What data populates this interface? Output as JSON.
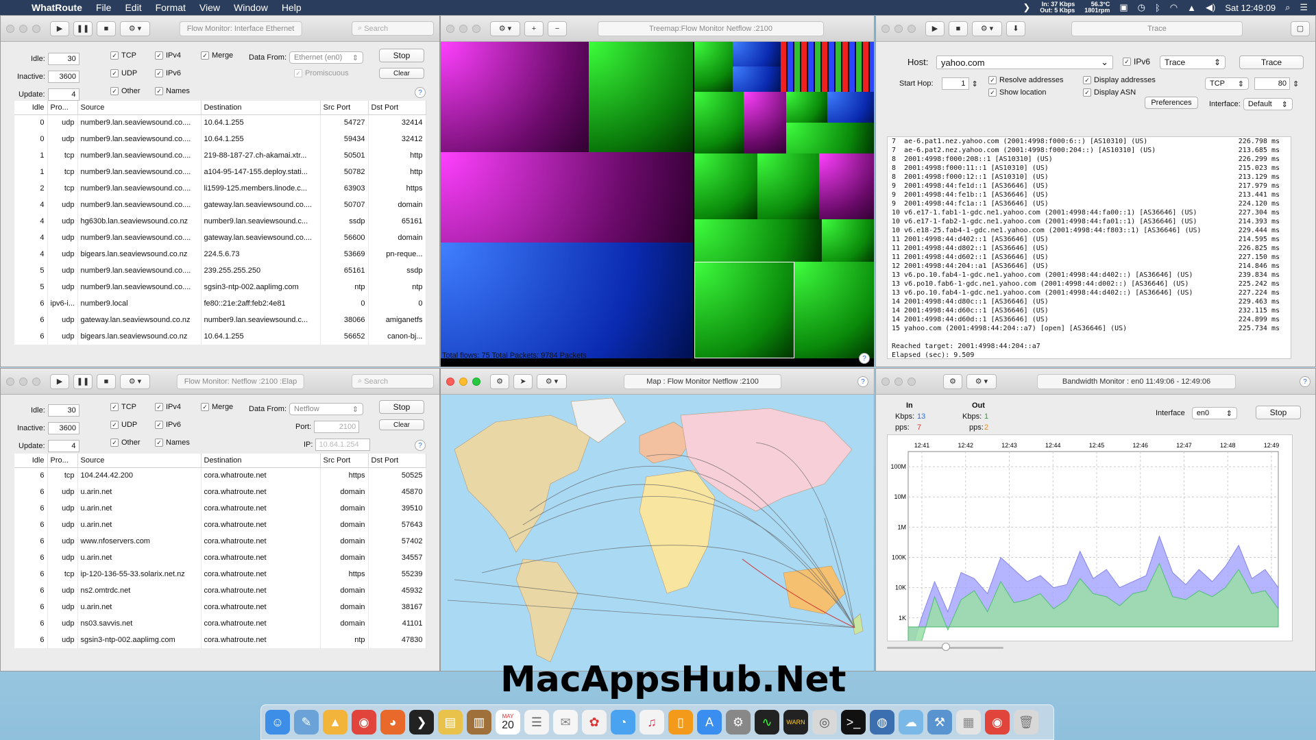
{
  "menubar": {
    "app": "WhatRoute",
    "menus": [
      "File",
      "Edit",
      "Format",
      "View",
      "Window",
      "Help"
    ],
    "net_in": "In: 37 Kbps",
    "net_out": "Out: 5 Kbps",
    "temp": "56.3°C",
    "rpm": "1801rpm",
    "clock": "Sat 12:49:09"
  },
  "fm1": {
    "title": "Flow Monitor: Interface Ethernet",
    "search_placeholder": "Search",
    "idle_label": "Idle:",
    "idle_value": "30",
    "inactive_label": "Inactive:",
    "inactive_value": "3600",
    "update_label": "Update:",
    "update_value": "4",
    "tcp": "TCP",
    "udp": "UDP",
    "other": "Other",
    "ipv4": "IPv4",
    "ipv6": "IPv6",
    "names": "Names",
    "merge": "Merge",
    "promiscuous": "Promiscuous",
    "data_from_label": "Data From:",
    "data_from_value": "Ethernet (en0)",
    "stop": "Stop",
    "clear": "Clear",
    "columns": [
      "Idle",
      "Pro...",
      "Source",
      "Destination",
      "Src Port",
      "Dst Port"
    ],
    "rows": [
      [
        "0",
        "udp",
        "number9.lan.seaviewsound.co....",
        "10.64.1.255",
        "54727",
        "32414"
      ],
      [
        "0",
        "udp",
        "number9.lan.seaviewsound.co....",
        "10.64.1.255",
        "59434",
        "32412"
      ],
      [
        "1",
        "tcp",
        "number9.lan.seaviewsound.co....",
        "219-88-187-27.ch-akamai.xtr...",
        "50501",
        "http"
      ],
      [
        "1",
        "tcp",
        "number9.lan.seaviewsound.co....",
        "a104-95-147-155.deploy.stati...",
        "50782",
        "http"
      ],
      [
        "2",
        "tcp",
        "number9.lan.seaviewsound.co....",
        "li1599-125.members.linode.c...",
        "63903",
        "https"
      ],
      [
        "4",
        "udp",
        "number9.lan.seaviewsound.co....",
        "gateway.lan.seaviewsound.co....",
        "50707",
        "domain"
      ],
      [
        "4",
        "udp",
        "hg630b.lan.seaviewsound.co.nz",
        "number9.lan.seaviewsound.c...",
        "ssdp",
        "65161"
      ],
      [
        "4",
        "udp",
        "number9.lan.seaviewsound.co....",
        "gateway.lan.seaviewsound.co....",
        "56600",
        "domain"
      ],
      [
        "4",
        "udp",
        "bigears.lan.seaviewsound.co.nz",
        "224.5.6.73",
        "53669",
        "pn-reque..."
      ],
      [
        "5",
        "udp",
        "number9.lan.seaviewsound.co....",
        "239.255.255.250",
        "65161",
        "ssdp"
      ],
      [
        "5",
        "udp",
        "number9.lan.seaviewsound.co....",
        "sgsin3-ntp-002.aaplimg.com",
        "ntp",
        "ntp"
      ],
      [
        "6",
        "ipv6-i...",
        "number9.local",
        "fe80::21e:2aff:feb2:4e81",
        "0",
        "0"
      ],
      [
        "6",
        "udp",
        "gateway.lan.seaviewsound.co.nz",
        "number9.lan.seaviewsound.c...",
        "38066",
        "amiganetfs"
      ],
      [
        "6",
        "udp",
        "bigears.lan.seaviewsound.co.nz",
        "10.64.1.255",
        "56652",
        "canon-bj..."
      ]
    ]
  },
  "fm2": {
    "title": "Flow Monitor: Netflow :2100 :Elap",
    "search_placeholder": "Search",
    "idle_label": "Idle:",
    "idle_value": "30",
    "inactive_label": "Inactive:",
    "inactive_value": "3600",
    "update_label": "Update:",
    "update_value": "4",
    "tcp": "TCP",
    "udp": "UDP",
    "other": "Other",
    "ipv4": "IPv4",
    "ipv6": "IPv6",
    "names": "Names",
    "merge": "Merge",
    "data_from_label": "Data From:",
    "data_from_value": "Netflow",
    "port_label": "Port:",
    "port_value": "2100",
    "ip_label": "IP:",
    "ip_placeholder": "10.64.1.254",
    "stop": "Stop",
    "clear": "Clear",
    "columns": [
      "Idle",
      "Pro...",
      "Source",
      "Destination",
      "Src Port",
      "Dst Port"
    ],
    "rows": [
      [
        "6",
        "tcp",
        "104.244.42.200",
        "cora.whatroute.net",
        "https",
        "50525"
      ],
      [
        "6",
        "udp",
        "u.arin.net",
        "cora.whatroute.net",
        "domain",
        "45870"
      ],
      [
        "6",
        "udp",
        "u.arin.net",
        "cora.whatroute.net",
        "domain",
        "39510"
      ],
      [
        "6",
        "udp",
        "u.arin.net",
        "cora.whatroute.net",
        "domain",
        "57643"
      ],
      [
        "6",
        "udp",
        "www.nfoservers.com",
        "cora.whatroute.net",
        "domain",
        "57402"
      ],
      [
        "6",
        "udp",
        "u.arin.net",
        "cora.whatroute.net",
        "domain",
        "34557"
      ],
      [
        "6",
        "tcp",
        "ip-120-136-55-33.solarix.net.nz",
        "cora.whatroute.net",
        "https",
        "55239"
      ],
      [
        "6",
        "udp",
        "ns2.omtrdc.net",
        "cora.whatroute.net",
        "domain",
        "45932"
      ],
      [
        "6",
        "udp",
        "u.arin.net",
        "cora.whatroute.net",
        "domain",
        "38167"
      ],
      [
        "6",
        "udp",
        "ns03.savvis.net",
        "cora.whatroute.net",
        "domain",
        "41101"
      ],
      [
        "6",
        "udp",
        "sgsin3-ntp-002.aaplimg.com",
        "cora.whatroute.net",
        "ntp",
        "47830"
      ]
    ]
  },
  "treemap": {
    "title": "Treemap:Flow Monitor Netflow :2100",
    "status": "Total flows: 75 Total Packets: 9784 Packets"
  },
  "map": {
    "title": "Map : Flow Monitor Netflow :2100"
  },
  "trace": {
    "title": "Trace",
    "host_label": "Host:",
    "host_value": "yahoo.com",
    "ipv6": "IPv6",
    "mode": "Trace",
    "trace_btn": "Trace",
    "start_hop_label": "Start Hop:",
    "start_hop_value": "1",
    "resolve": "Resolve addresses",
    "show_location": "Show location",
    "display_addresses": "Display addresses",
    "display_asn": "Display ASN",
    "proto": "TCP",
    "port": "80",
    "preferences": "Preferences",
    "interface_label": "Interface:",
    "interface_value": "Default",
    "lines": [
      [
        "7  ae-6.pat1.nez.yahoo.com (2001:4998:f000:6::) [AS10310] (US)",
        "226.798 ms"
      ],
      [
        "7  ae-6.pat2.nez.yahoo.com (2001:4998:f000:204::) [AS10310] (US)",
        "213.685 ms"
      ],
      [
        "8  2001:4998:f000:208::1 [AS10310] (US)",
        "226.299 ms"
      ],
      [
        "8  2001:4998:f000:11::1 [AS10310] (US)",
        "215.023 ms"
      ],
      [
        "8  2001:4998:f000:12::1 [AS10310] (US)",
        "213.129 ms"
      ],
      [
        "9  2001:4998:44:fe1d::1 [AS36646] (US)",
        "217.979 ms"
      ],
      [
        "9  2001:4998:44:fe1b::1 [AS36646] (US)",
        "213.441 ms"
      ],
      [
        "9  2001:4998:44:fc1a::1 [AS36646] (US)",
        "224.120 ms"
      ],
      [
        "10 v6.e17-1.fab1-1-gdc.ne1.yahoo.com (2001:4998:44:fa00::1) [AS36646] (US)",
        "227.304 ms"
      ],
      [
        "10 v6.e17-1-fab2-1-gdc.ne1.yahoo.com (2001:4998:44:fa01::1) [AS36646] (US)",
        "214.393 ms"
      ],
      [
        "10 v6.e18-25.fab4-1-gdc.ne1.yahoo.com (2001:4998:44:f803::1) [AS36646] (US)",
        "229.444 ms"
      ],
      [
        "11 2001:4998:44:d402::1 [AS36646] (US)",
        "214.595 ms"
      ],
      [
        "11 2001:4998:44:d802::1 [AS36646] (US)",
        "226.825 ms"
      ],
      [
        "11 2001:4998:44:d602::1 [AS36646] (US)",
        "227.150 ms"
      ],
      [
        "12 2001:4998:44:204::a1 [AS36646] (US)",
        "214.846 ms"
      ],
      [
        "13 v6.po.10.fab4-1-gdc.ne1.yahoo.com (2001:4998:44:d402::) [AS36646] (US)",
        "239.834 ms"
      ],
      [
        "13 v6.po10.fab6-1-gdc.ne1.yahoo.com (2001:4998:44:d002::) [AS36646] (US)",
        "225.242 ms"
      ],
      [
        "13 v6.po.10.fab4-1-gdc.ne1.yahoo.com (2001:4998:44:d402::) [AS36646] (US)",
        "227.224 ms"
      ],
      [
        "14 2001:4998:44:d80c::1 [AS36646] (US)",
        "229.463 ms"
      ],
      [
        "14 2001:4998:44:d60c::1 [AS36646] (US)",
        "232.115 ms"
      ],
      [
        "14 2001:4998:44:d60d::1 [AS36646] (US)",
        "224.899 ms"
      ],
      [
        "15 yahoo.com (2001:4998:44:204::a7) [open] [AS36646] (US)",
        "225.734 ms"
      ]
    ],
    "reached": "Reached target: 2001:4998:44:204::a7",
    "elapsed": "Elapsed (sec): 9.509"
  },
  "bandwidth": {
    "title": "Bandwidth Monitor : en0 11:49:06 - 12:49:06",
    "in_label": "In",
    "out_label": "Out",
    "kbps_label": "Kbps:",
    "pps_label": "pps:",
    "in_kbps": "13",
    "in_pps": "7",
    "out_kbps": "1",
    "out_pps": "2",
    "interface_label": "Interface",
    "interface_value": "en0",
    "stop": "Stop",
    "in_color": "#2a6fdb",
    "pps_color": "#d63a2a",
    "out_kbps_color": "#2aa02a",
    "out_pps_color": "#e08a1a",
    "chart_data": {
      "type": "area",
      "x": [
        "12:41",
        "12:42",
        "12:43",
        "12:44",
        "12:45",
        "12:46",
        "12:47",
        "12:48",
        "12:49"
      ],
      "ylabels": [
        "100M",
        "10M",
        "1M",
        "100K",
        "10K",
        "1K"
      ],
      "series": [
        {
          "values": [
            1.5,
            3,
            4.2,
            3.2,
            4.5,
            4.3,
            3.8,
            5,
            4.6,
            4.2,
            4.4,
            4,
            4.1,
            5.2,
            4.3,
            4.6,
            4,
            4.2,
            4.4,
            5.7,
            4.5,
            4.1,
            4.6,
            4.2,
            4.7,
            5.4,
            4.3,
            4.6,
            4
          ]
        },
        {
          "values": [
            1,
            2.2,
            3.7,
            2.6,
            3.6,
            3.9,
            3.2,
            4.2,
            3.5,
            3.6,
            3.8,
            3.3,
            3.6,
            4.3,
            3.8,
            3.7,
            3.4,
            3.8,
            3.9,
            4.8,
            3.7,
            3.6,
            3.9,
            3.7,
            4,
            4.6,
            3.8,
            3.9,
            3.3
          ]
        }
      ]
    }
  },
  "watermark": "MacAppsHub.Net",
  "dock": {
    "calendar_month": "MAY",
    "calendar_day": "20"
  }
}
